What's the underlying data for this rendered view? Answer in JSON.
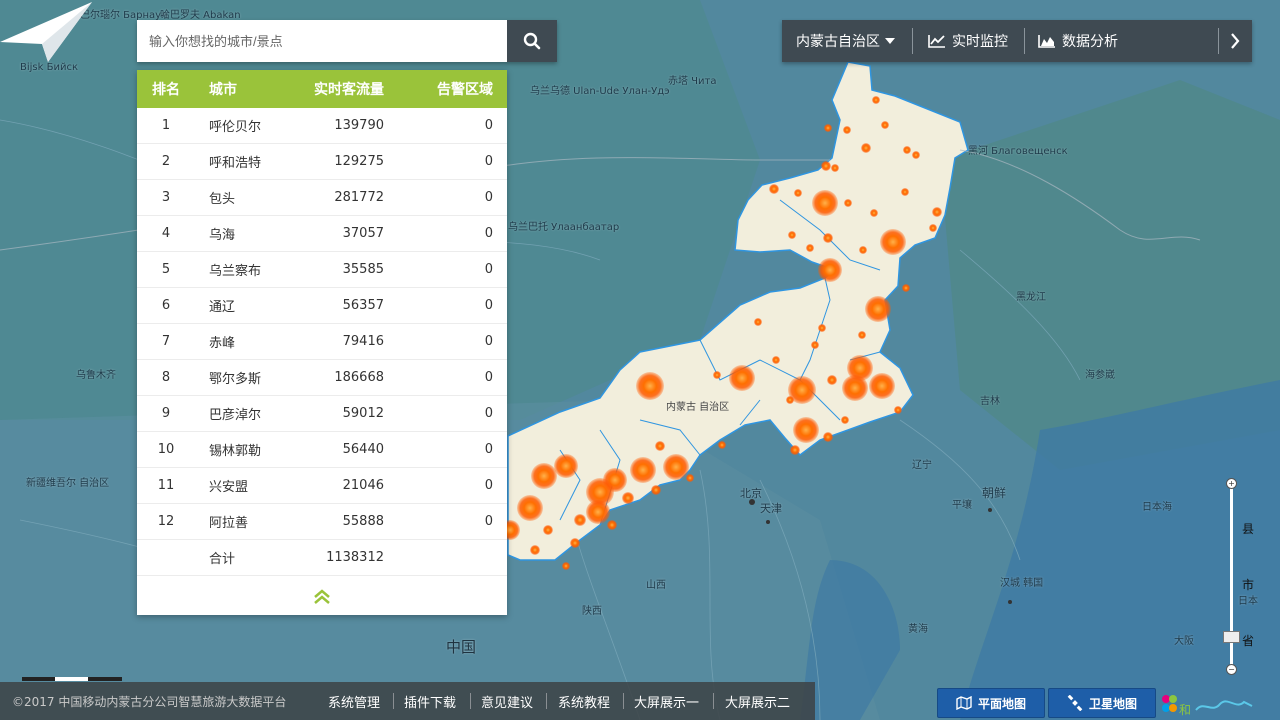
{
  "search": {
    "placeholder": "输入你想找的城市/景点"
  },
  "table": {
    "headers": {
      "rank": "排名",
      "city": "城市",
      "flow": "实时客流量",
      "alert": "告警区域"
    },
    "rows": [
      {
        "rank": "1",
        "city": "呼伦贝尔",
        "flow": "139790",
        "alert": "0"
      },
      {
        "rank": "2",
        "city": "呼和浩特",
        "flow": "129275",
        "alert": "0"
      },
      {
        "rank": "3",
        "city": "包头",
        "flow": "281772",
        "alert": "0"
      },
      {
        "rank": "4",
        "city": "乌海",
        "flow": "37057",
        "alert": "0"
      },
      {
        "rank": "5",
        "city": "乌兰察布",
        "flow": "35585",
        "alert": "0"
      },
      {
        "rank": "6",
        "city": "通辽",
        "flow": "56357",
        "alert": "0"
      },
      {
        "rank": "7",
        "city": "赤峰",
        "flow": "79416",
        "alert": "0"
      },
      {
        "rank": "8",
        "city": "鄂尔多斯",
        "flow": "186668",
        "alert": "0"
      },
      {
        "rank": "9",
        "city": "巴彦淖尔",
        "flow": "59012",
        "alert": "0"
      },
      {
        "rank": "10",
        "city": "锡林郭勒",
        "flow": "56440",
        "alert": "0"
      },
      {
        "rank": "11",
        "city": "兴安盟",
        "flow": "21046",
        "alert": "0"
      },
      {
        "rank": "12",
        "city": "阿拉善",
        "flow": "55888",
        "alert": "0"
      }
    ],
    "total": {
      "label": "合计",
      "flow": "1138312"
    },
    "collapse_icon": "double-chevron-up-icon"
  },
  "topbar": {
    "region": "内蒙古自治区",
    "monitor": "实时监控",
    "analysis": "数据分析"
  },
  "footer": {
    "copyright": "©2017 中国移动内蒙古分公司智慧旅游大数据平台",
    "links": [
      "系统管理",
      "插件下载",
      "意见建议",
      "系统教程",
      "大屏展示一",
      "大屏展示二"
    ]
  },
  "map_buttons": {
    "flat": "平面地图",
    "satellite": "卫星地图"
  },
  "zoom": {
    "labels": [
      "县",
      "市",
      "省"
    ],
    "level_fraction": 0.82
  },
  "map": {
    "labels": [
      "巴尔瑙尔 Барнаул",
      "哈巴罗夫 Abakan",
      "Bijsk Бийск",
      "乌兰乌德 Ulan-Ude Улан-Удэ",
      "赤塔 Чита",
      "乌兰巴托 Улаанбаатар",
      "黑河 Благовещенск",
      "内蒙古 自治区",
      "北京",
      "天津",
      "朝鲜",
      "平壤",
      "汉城 韩国",
      "日本海",
      "海参崴",
      "乌鲁木齐",
      "新疆维吾尔 自治区",
      "中国",
      "黄海",
      "大阪",
      "山西",
      "陕西",
      "吉林",
      "黑龙江",
      "辽宁",
      "日本"
    ],
    "colors": {
      "region_fill": "#f3efde",
      "region_border": "#2f95e0",
      "hotspot": "#ff6a00",
      "sea": "#4d7f99"
    }
  },
  "brand": {
    "text": "和"
  }
}
